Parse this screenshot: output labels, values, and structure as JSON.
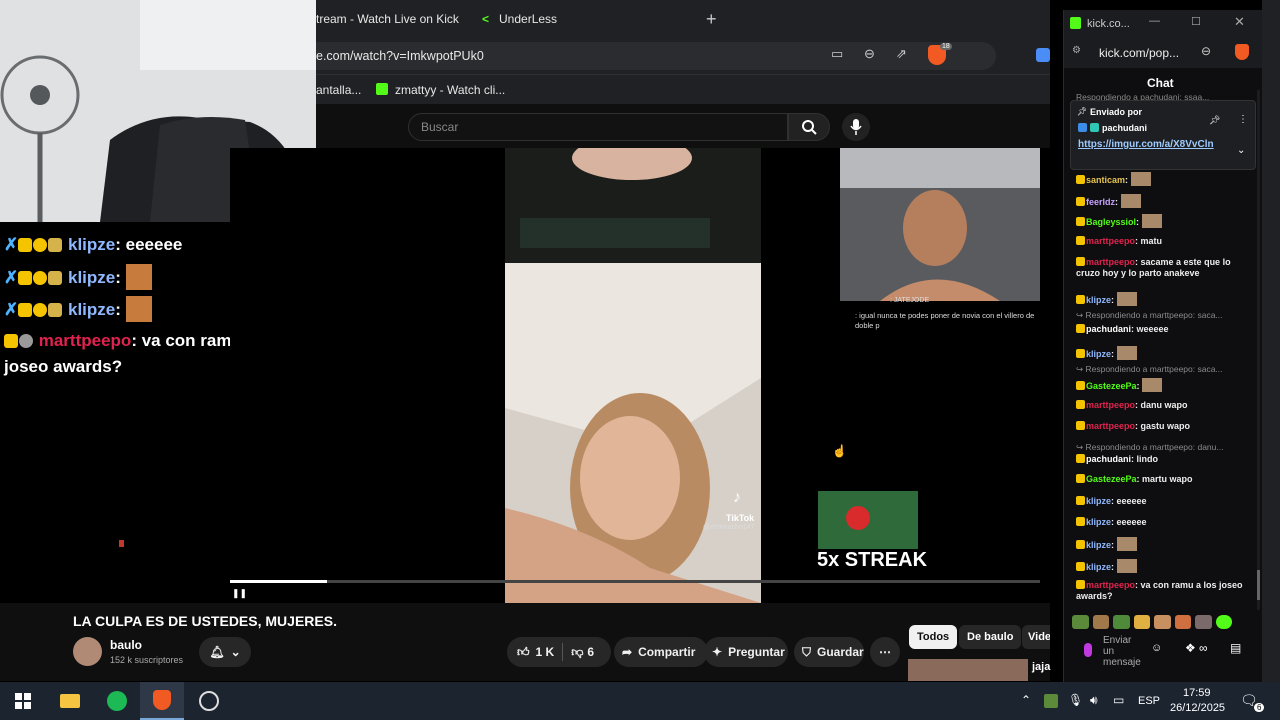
{
  "tabs": [
    {
      "label": "tream - Watch Live on Kick"
    },
    {
      "label": "UnderLess"
    }
  ],
  "address": {
    "url": "e.com/watch?v=ImkwpotPUk0",
    "brave_badge": "18"
  },
  "bookmarks": [
    {
      "label": "antalla..."
    },
    {
      "label": "zmattyy - Watch cli..."
    }
  ],
  "youtube": {
    "search_placeholder": "Buscar",
    "title": "LA CULPA ES DE USTEDES, MUJERES.",
    "channel": "baulo",
    "subscribers": "152 k suscriptores",
    "likes": "1 K",
    "dislikes": "6",
    "share": "Compartir",
    "ask": "Preguntar",
    "save": "Guardar",
    "filters": [
      "Todos",
      "De baulo",
      "Vide"
    ],
    "side_text": "jaja",
    "progress": 0.12
  },
  "video_overlay": {
    "tiktok_label": "TikTok",
    "tiktok_user": "@elmorocho147",
    "streak": "5x STREAK",
    "cam_chat_1": ": igual nunca te podes poner de novia con el villero de doble p",
    "cam_chat_top": ": JATEJODE"
  },
  "left_chat": [
    {
      "user": "klipze",
      "text": "eeeeee",
      "color": "#8fb8ff"
    },
    {
      "user": "klipze",
      "text": "",
      "color": "#8fb8ff"
    },
    {
      "user": "klipze",
      "text": "",
      "color": "#8fb8ff"
    },
    {
      "user": "marttpeepo",
      "text": "va con ramu a los joseo awards?",
      "color": "#e0234e"
    }
  ],
  "kick": {
    "tab_title": "kick.co...",
    "url": "kick.com/pop...",
    "chat_title": "Chat",
    "pinned_label": "Enviado por",
    "pinned_user": "pachudani",
    "pinned_link": "https://imgur.com/a/X8VvCln",
    "reply_prefix_1": "Respondiendo a pachudani: ssaa...",
    "messages": [
      {
        "user": "santicam",
        "text": "",
        "color": "#e5c452"
      },
      {
        "user": "feerldz",
        "text": "",
        "color": "#c8a2ff"
      },
      {
        "user": "Bagleyssiol",
        "text": "",
        "color": "#53fc18"
      },
      {
        "user": "marttpeepo",
        "text": "matu",
        "color": "#e0234e"
      },
      {
        "user": "marttpeepo",
        "text": "sacame a este que lo cruzo hoy y lo parto anakeve",
        "color": "#e0234e"
      },
      {
        "user": "klipze",
        "text": "",
        "color": "#8fb8ff"
      },
      {
        "reply": "Respondiendo a marttpeepo: saca..."
      },
      {
        "user": "pachudani",
        "text": "weeeee",
        "color": "#ffffff"
      },
      {
        "user": "klipze",
        "text": "",
        "color": "#8fb8ff"
      },
      {
        "reply": "Respondiendo a marttpeepo: saca..."
      },
      {
        "user": "GastezeePa",
        "text": "",
        "color": "#53fc18"
      },
      {
        "user": "marttpeepo",
        "text": "danu wapo",
        "color": "#e0234e"
      },
      {
        "user": "marttpeepo",
        "text": "gastu wapo",
        "color": "#e0234e"
      },
      {
        "reply": "Respondiendo a marttpeepo: danu..."
      },
      {
        "user": "pachudani",
        "text": "lindo",
        "color": "#ffffff"
      },
      {
        "user": "GastezeePa",
        "text": "martu wapo",
        "color": "#53fc18"
      },
      {
        "user": "klipze",
        "text": "eeeeee",
        "color": "#8fb8ff"
      },
      {
        "user": "klipze",
        "text": "eeeeee",
        "color": "#8fb8ff"
      },
      {
        "user": "klipze",
        "text": "",
        "color": "#8fb8ff"
      },
      {
        "user": "klipze",
        "text": "",
        "color": "#8fb8ff"
      },
      {
        "user": "marttpeepo",
        "text": "va con ramu a los joseo awards?",
        "color": "#e0234e"
      }
    ],
    "input_placeholder": "Enviar un mensaje"
  },
  "taskbar": {
    "lang": "ESP",
    "time": "17:59",
    "date": "26/12/2025",
    "notif_count": "6"
  }
}
